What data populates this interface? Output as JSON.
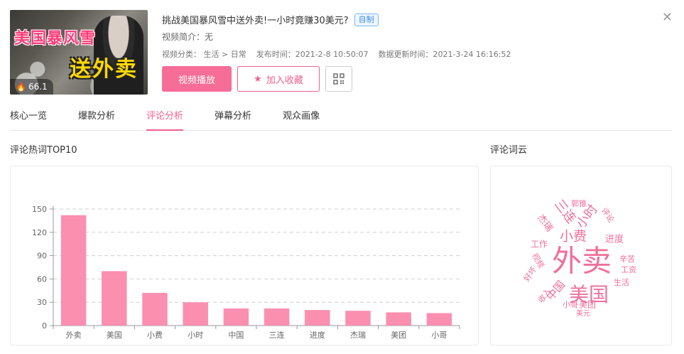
{
  "video": {
    "thumb_text_top": "美国暴风雪",
    "thumb_text_bottom": "送外卖",
    "heat": "66.1",
    "title": "挑战美国暴风雪中送外卖!一小时竟赚30美元?",
    "tag": "自制",
    "intro": "视频简介：无",
    "category": "视频分类：  生活 > 日常",
    "publish_time": "发布时间：2021-2-8 10:50:07",
    "update_time": "数据更新时间：2021-3-24 16:16:52"
  },
  "actions": {
    "play_label": "视频播放",
    "fav_label": "加入收藏"
  },
  "tabs": [
    {
      "label": "核心一览"
    },
    {
      "label": "爆款分析"
    },
    {
      "label": "评论分析",
      "active": true
    },
    {
      "label": "弹幕分析"
    },
    {
      "label": "观众画像"
    }
  ],
  "sections": {
    "top10_title": "评论热词TOP10",
    "cloud_title": "评论词云"
  },
  "chart_data": {
    "type": "bar",
    "title": "",
    "categories": [
      "外卖",
      "美国",
      "小费",
      "小时",
      "中国",
      "三连",
      "进度",
      "杰瑞",
      "美团",
      "小哥"
    ],
    "values": [
      142,
      70,
      42,
      30,
      22,
      22,
      20,
      19,
      17,
      16
    ],
    "ylim": [
      0,
      150
    ],
    "yticks": [
      0,
      30,
      60,
      90,
      120,
      150
    ],
    "grid": true,
    "bar_color": "#fb8fb0"
  },
  "word_cloud": [
    {
      "text": "外卖",
      "color": "#f0709a"
    },
    {
      "text": "美国",
      "color": "#f0709a"
    },
    {
      "text": "小费",
      "color": "#f0709a"
    },
    {
      "text": "小时",
      "color": "#f0709a"
    },
    {
      "text": "三连",
      "color": "#f0709a"
    },
    {
      "text": "中国",
      "color": "#f0709a"
    },
    {
      "text": "进度",
      "color": "#f0709a"
    },
    {
      "text": "杰瑞",
      "color": "#f0709a"
    },
    {
      "text": "美团",
      "color": "#f0709a"
    },
    {
      "text": "小哥",
      "color": "#f0709a"
    },
    {
      "text": "工作",
      "color": "#f0709a"
    },
    {
      "text": "郭锥",
      "color": "#f0709a"
    },
    {
      "text": "评论",
      "color": "#f0709a"
    },
    {
      "text": "辛苦",
      "color": "#f0709a"
    },
    {
      "text": "工资",
      "color": "#f0709a"
    },
    {
      "text": "生活",
      "color": "#f0709a"
    },
    {
      "text": "视频",
      "color": "#f0709a"
    },
    {
      "text": "好坏",
      "color": "#f0709a"
    },
    {
      "text": "收入",
      "color": "#f0709a"
    },
    {
      "text": "美元",
      "color": "#f0709a"
    }
  ]
}
